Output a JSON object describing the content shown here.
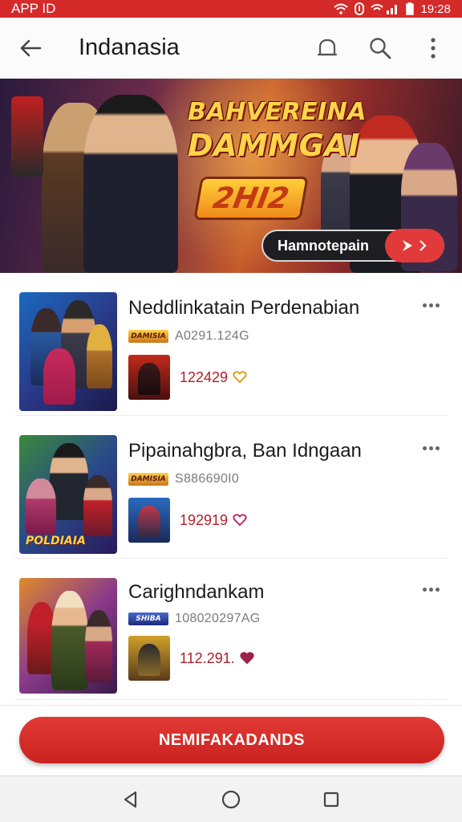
{
  "status_bar": {
    "left_text": "APP ID",
    "time": "19:28",
    "icons": [
      "wifi-icon",
      "vpn-icon",
      "signal-icon",
      "battery-icon"
    ]
  },
  "app_bar": {
    "title": "Indanasia",
    "icons": [
      "back-arrow-icon",
      "bell-icon",
      "search-icon",
      "more-vert-icon"
    ]
  },
  "banner": {
    "headline_line1": "BAHVEREINA",
    "headline_line2": "DAMMGAI",
    "year_badge": "2HI2",
    "cta_label": "Hamnotepain",
    "cta_icon": "play-arrow-icon"
  },
  "list": {
    "items": [
      {
        "name": "Neddlinkatain Perdenabian",
        "tag": "DAMISIA",
        "code": "A0291.124G",
        "score": "122429",
        "score_icon": "heart-icon",
        "heart_color": "#e0a020",
        "thumb_caption": ""
      },
      {
        "name": "Pipainahgbra, Ban Idngaan",
        "tag": "DAMISIA",
        "code": "S886690I0",
        "score": "192919",
        "score_icon": "heart-icon",
        "heart_color": "#c0306a",
        "thumb_caption": "POLDIAIA"
      },
      {
        "name": "Carighndankam",
        "tag": "SHIBA",
        "code": "108020297AG",
        "score": "112.291.",
        "score_icon": "heart-icon",
        "heart_color": "#a0204a",
        "thumb_caption": ""
      }
    ]
  },
  "primary_button": {
    "label": "NEMIFAKADANDS"
  },
  "nav_bar": {
    "icons": [
      "back-triangle-icon",
      "home-circle-icon",
      "recents-square-icon"
    ]
  },
  "colors": {
    "accent": "#d42a2a",
    "button": "#d9302c"
  }
}
